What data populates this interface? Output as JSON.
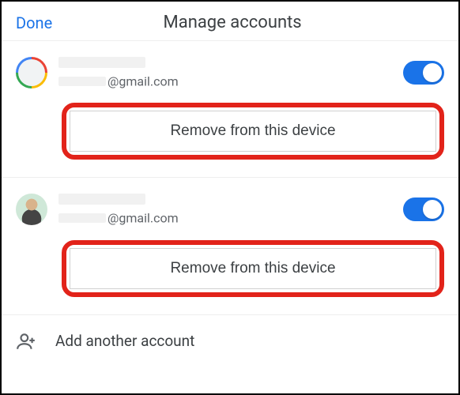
{
  "header": {
    "done_label": "Done",
    "title": "Manage accounts"
  },
  "accounts": [
    {
      "avatar_style": "google-ring",
      "email_domain": "@gmail.com",
      "toggle_on": true,
      "remove_label": "Remove from this device"
    },
    {
      "avatar_style": "photo",
      "email_domain": "@gmail.com",
      "toggle_on": true,
      "remove_label": "Remove from this device"
    }
  ],
  "footer": {
    "add_label": "Add another account"
  },
  "colors": {
    "accent": "#1a73e8",
    "highlight_ring": "#e2231a"
  }
}
